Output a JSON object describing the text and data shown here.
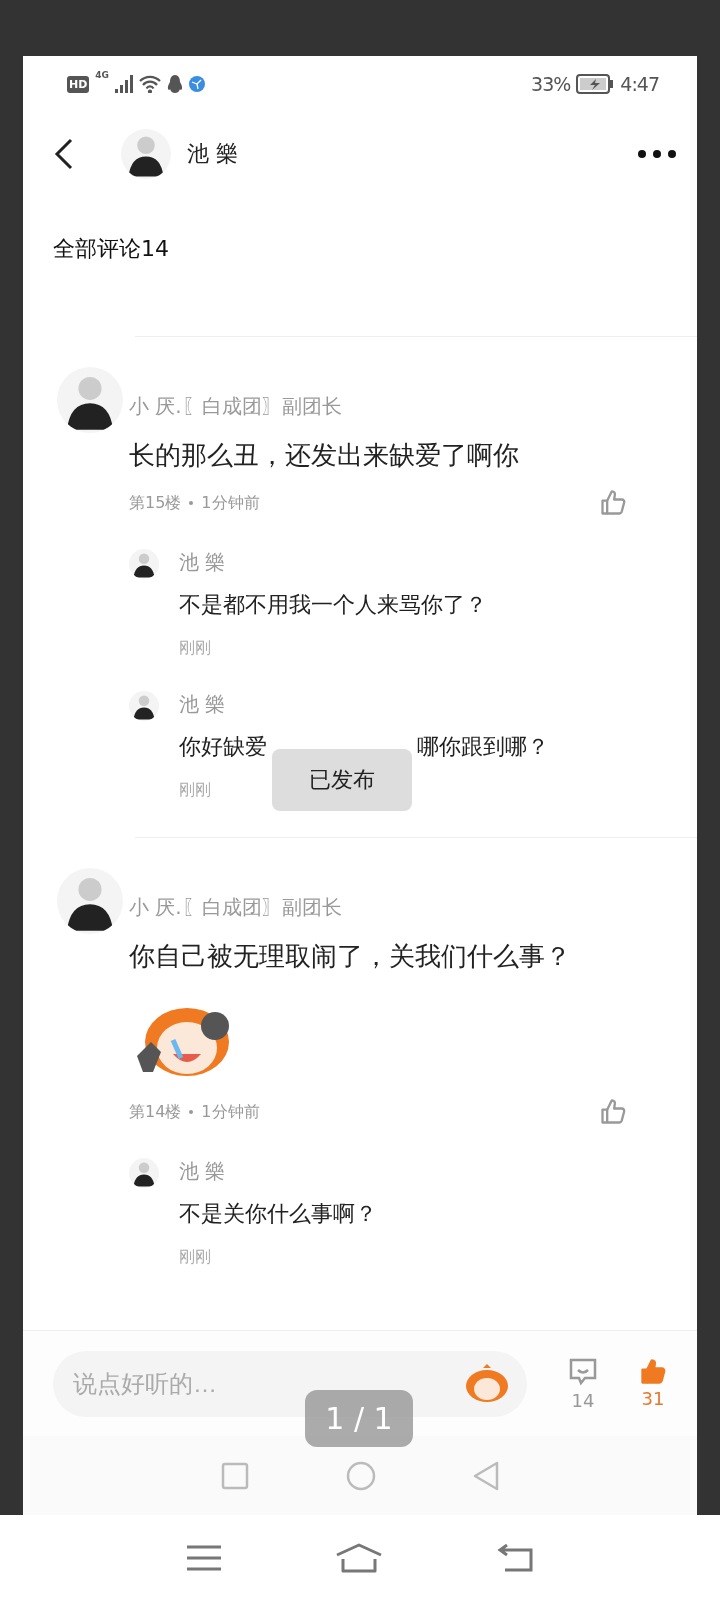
{
  "status_bar": {
    "hd": "HD",
    "network": "4G",
    "battery": "33%",
    "time": "4:47"
  },
  "header": {
    "name": "池 樂"
  },
  "section_title": "全部评论14",
  "comments": [
    {
      "author": "小 厌.〖白成团〗副团长",
      "text": "长的那么丑，还发出来缺爱了啊你",
      "sticker": false,
      "floor": "第15楼",
      "time": "1分钟前",
      "replies": [
        {
          "author": "池 樂",
          "text": [
            "不是都不用我一个人来骂你了？"
          ],
          "time": "刚刚"
        },
        {
          "author": "池 樂",
          "text": [
            "你好缺爱",
            "哪你跟到哪？"
          ],
          "time": "刚刚"
        }
      ]
    },
    {
      "author": "小 厌.〖白成团〗副团长",
      "text": "你自己被无理取闹了，关我们什么事？",
      "sticker": true,
      "floor": "第14楼",
      "time": "1分钟前",
      "replies": [
        {
          "author": "池 樂",
          "text": [
            "不是关你什么事啊？"
          ],
          "time": "刚刚"
        }
      ]
    }
  ],
  "toast": "已发布",
  "footer": {
    "placeholder": "说点好听的…",
    "comment_count": "14",
    "like_count": "31",
    "liked": true
  },
  "page_indicator": "1 / 1"
}
